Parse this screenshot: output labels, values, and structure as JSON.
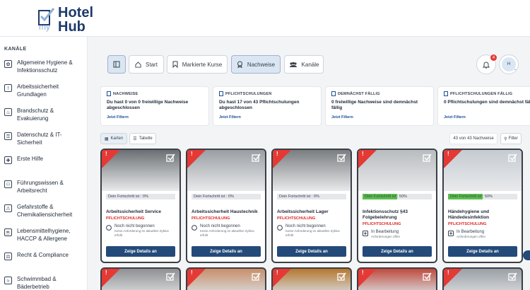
{
  "logo": {
    "my": "my",
    "hotel": "Hotel",
    "hub": "Hub"
  },
  "sidebar": {
    "title": "KANÄLE",
    "items": [
      {
        "label": "Allgemeine Hygiene & Infektionsschutz",
        "icon": "hygiene-icon"
      },
      {
        "label": "Arbeitssicherheit Grundlagen",
        "icon": "warning-icon"
      },
      {
        "label": "Brandschutz & Evakuierung",
        "icon": "fire-icon"
      },
      {
        "label": "Datenschutz & IT-Sicherheit",
        "icon": "lock-icon"
      },
      {
        "label": "Erste Hilfe",
        "icon": "first-aid-icon"
      },
      {
        "label": "Führungswissen & Arbeitsrecht",
        "icon": "people-icon"
      },
      {
        "label": "Gefahrstoffe & Chemikaliensicherheit",
        "icon": "hazard-icon"
      },
      {
        "label": "Lebensmittelhygiene, HACCP & Allergene",
        "icon": "food-icon"
      },
      {
        "label": "Recht & Compliance",
        "icon": "scale-icon"
      },
      {
        "label": "Schwimmbad & Bäderbetrieb",
        "icon": "pool-icon"
      }
    ]
  },
  "nav": {
    "start": "Start",
    "marked": "Markierte Kurse",
    "proofs": "Nachweise",
    "channels": "Kanäle",
    "notif_count": "4",
    "avatar_initial": "H"
  },
  "stats": [
    {
      "heading": "NACHWEISE",
      "text": "Du hast 0 von 0 freiwillige Nachweise abgeschlossen",
      "link": "Jetzt Filtern"
    },
    {
      "heading": "PFLICHTSCHULUNGEN",
      "text": "Du hast 17 von 43 Pflichtschulungen abgeschlossen",
      "link": "Jetzt Filtern"
    },
    {
      "heading": "DEMNÄCHST FÄLLIG",
      "text": "0 freiwillige Nachweise sind demnächst fällig",
      "link": "Jetzt Filtern"
    },
    {
      "heading": "PFLICHTSCHULUNGEN FÄLLIG",
      "text": "0 Pflichtschulungen sind demnächst fällig",
      "link": "Jetzt Filtern"
    }
  ],
  "view": {
    "cards": "Karten",
    "table": "Tabelle",
    "count": "43 von 43 Nachweise",
    "filter": "Filter"
  },
  "cards": [
    {
      "title": "Arbeitssicherheit Service",
      "type": "PFLICHTSCHULUNG",
      "progress_label": "Dein Fortschritt ist : 0%",
      "progress": 0,
      "status": "Noch nicht begonnen",
      "status_sub": "Keine Anforderung im aktuellen Zyklus erfüllt",
      "button": "Zeige Details an",
      "img_color": "#6b6f73"
    },
    {
      "title": "Arbeitssicherheit Haustechnik",
      "type": "PFLICHTSCHULUNG",
      "progress_label": "Dein Fortschritt ist : 0%",
      "progress": 0,
      "status": "Noch nicht begonnen",
      "status_sub": "Keine Anforderung im aktuellen Zyklus erfüllt",
      "button": "Zeige Details an",
      "img_color": "#9a9ea3"
    },
    {
      "title": "Arbeitssicherheit Lager",
      "type": "PFLICHTSCHULUNG",
      "progress_label": "Dein Fortschritt ist : 0%",
      "progress": 0,
      "status": "Noch nicht begonnen",
      "status_sub": "Keine Anforderung im aktuellen Zyklus erfüllt",
      "button": "Zeige Details an",
      "img_color": "#7a7d80"
    },
    {
      "title": "Infektionsschutz §43 Folgebelehrung",
      "type": "PFLICHTSCHULUNG",
      "progress_label": "Dein Fortschritt ist : 50%",
      "progress": 50,
      "status": "In Bearbeitung",
      "status_sub": "Anforderungen offen",
      "button": "Zeige Details an",
      "img_color": "#b9bcbf"
    },
    {
      "title": "Händehygiene und Händedesinfektion",
      "type": "PFLICHTSCHULUNG",
      "progress_label": "Dein Fortschritt ist : 50%",
      "progress": 50,
      "status": "In Bearbeitung",
      "status_sub": "Anforderungen offen",
      "button": "Zeige Details an",
      "img_color": "#c5cbd1"
    }
  ],
  "cards_row2_colors": [
    "#8e9094",
    "#c98f6a",
    "#b5772f",
    "#c04a3d",
    "#9aa0a6"
  ]
}
